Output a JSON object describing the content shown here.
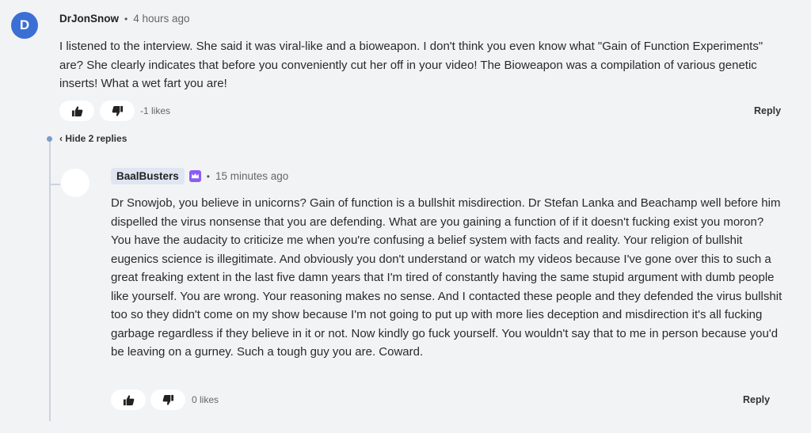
{
  "comment": {
    "avatar_letter": "D",
    "author": "DrJonSnow",
    "separator": "•",
    "time": "4 hours ago",
    "body": "I listened to the interview. She said it was viral-like and a bioweapon. I don't think you even know what \"Gain of Function Experiments\" are? She clearly indicates that before you conveniently cut her off in your video! The Bioweapon was a compilation of various genetic inserts! What a wet fart you are!",
    "likes": "-1 likes",
    "reply_label": "Reply"
  },
  "thread": {
    "hide_replies_label": "‹ Hide 2 replies"
  },
  "reply": {
    "author": "BaalBusters",
    "separator": "•",
    "time": "15 minutes ago",
    "body": "Dr Snowjob, you believe in unicorns? Gain of function is a bullshit misdirection. Dr Stefan Lanka and Beachamp well before him dispelled the virus nonsense that you are defending. What are you gaining a function of if it doesn't fucking exist you moron? You have the audacity to criticize me when you're confusing a belief system with facts and reality. Your religion of bullshit eugenics science is illegitimate. And obviously you don't understand or watch my videos because I've gone over this to such a great freaking extent in the last five damn years that I'm tired of constantly having the same stupid argument with dumb people like yourself. You are wrong. Your reasoning makes no sense. And I contacted these people and they defended the virus bullshit too so they didn't come on my show because I'm not going to put up with more lies deception and misdirection it's all fucking garbage regardless if they believe in it or not. Now kindly go fuck yourself. You wouldn't say that to me in person because you'd be leaving on a gurney. Such a tough guy you are. Coward.",
    "likes": "0 likes",
    "reply_label": "Reply"
  },
  "icons": {
    "like": "thumbs-up-icon",
    "dislike": "thumbs-down-icon",
    "badge": "crown-badge-icon"
  },
  "colors": {
    "background": "#f2f3f5",
    "avatar": "#3b6fd4",
    "badge": "#8b5cf6",
    "thread_line": "#c9d3e2"
  }
}
